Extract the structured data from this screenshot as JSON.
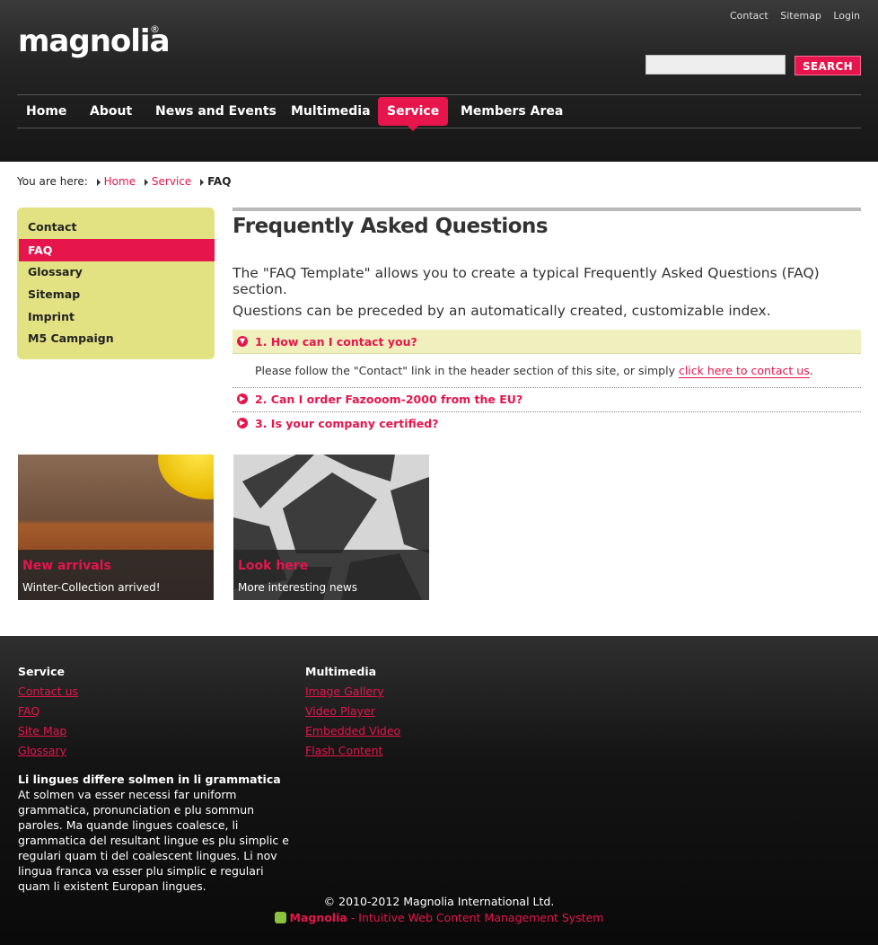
{
  "header": {
    "logo_text": "magnolia",
    "logo_reg": "®",
    "meta_links": [
      "Contact",
      "Sitemap",
      "Login"
    ],
    "search": {
      "placeholder": "",
      "button_label": "SEARCH"
    },
    "nav": [
      {
        "label": "Home"
      },
      {
        "label": "About"
      },
      {
        "label": "News and Events"
      },
      {
        "label": "Multimedia"
      },
      {
        "label": "Service",
        "active": true
      },
      {
        "label": "Members Area"
      }
    ]
  },
  "breadcrumb": {
    "prefix": "You are here:",
    "items": [
      "Home",
      "Service"
    ],
    "current": "FAQ"
  },
  "subnav": {
    "items": [
      {
        "label": "Contact"
      },
      {
        "label": "FAQ",
        "active": true
      },
      {
        "label": "Glossary"
      },
      {
        "label": "Sitemap"
      },
      {
        "label": "Imprint"
      },
      {
        "label": "M5 Campaign"
      }
    ]
  },
  "main": {
    "title": "Frequently Asked Questions",
    "intro_1": "The \"FAQ Template\" allows you to create a typical Frequently Asked Questions (FAQ) section.",
    "intro_2": "Questions can be preceded by an automatically created, customizable index.",
    "faq": [
      {
        "question": "1. How can I contact you?",
        "answer_prefix": "Please follow the \"Contact\" link in the header section of this site, or simply",
        "answer_link": "click here to contact us",
        "answer_suffix": "."
      },
      {
        "question": "2. Can I order Fazooom-2000 from the EU?"
      },
      {
        "question": "3. Is your company certified?"
      }
    ]
  },
  "teasers": [
    {
      "title": "New arrivals",
      "text": "Winter-Collection arrived!"
    },
    {
      "title": "Look here",
      "text": "More interesting news"
    }
  ],
  "footer": {
    "col1": {
      "heading": "Service",
      "links": [
        "Contact us",
        "FAQ",
        "Site Map",
        "Glossary"
      ]
    },
    "col2": {
      "heading": "Multimedia",
      "links": [
        "Image Gallery",
        "Video Player",
        "Embedded Video",
        "Flash Content"
      ]
    },
    "text_heading": "Li lingues differe solmen in li grammatica",
    "text_body": "At solmen va esser necessi far uniform grammatica, pronunciation e plu sommun paroles. Ma quande lingues coalesce, li grammatica del resultant lingue es plu simplic e regulari quam ti del coalescent lingues. Li nov lingua franca va esser plu simplic e regulari quam li existent Europan lingues.",
    "copyright": "© 2010-2012 Magnolia International Ltd.",
    "powered_brand": "Magnolia",
    "powered_text": "- Intuitive Web Content Management System"
  },
  "colors": {
    "accent": "#e6154c",
    "subnav_bg": "#e3e282",
    "faq_open_bg": "#eff0bd"
  }
}
